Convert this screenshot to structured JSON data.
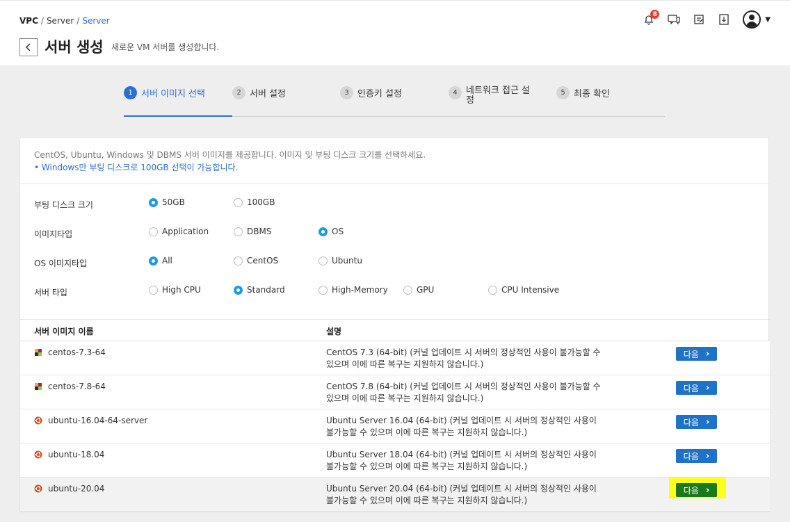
{
  "breadcrumb": {
    "item1": "VPC",
    "item2": "Server",
    "item3": "Server",
    "sep": "/"
  },
  "page": {
    "title": "서버 생성",
    "subtitle": "새로운 VM 서버를 생성합니다."
  },
  "header": {
    "notification_count": "8"
  },
  "steps": [
    {
      "num": "1",
      "label": "서버 이미지 선택"
    },
    {
      "num": "2",
      "label": "서버 설정"
    },
    {
      "num": "3",
      "label": "인증키 설정"
    },
    {
      "num": "4",
      "label": "네트워크 접근 설정"
    },
    {
      "num": "5",
      "label": "최종 확인"
    }
  ],
  "info": {
    "text": "CentOS, Ubuntu, Windows 및 DBMS 서버 이미지를 제공합니다. 이미지 및 부팅 디스크 크기를 선택하세요.",
    "note": "Windows만 부팅 디스크로 100GB 선택이 가능합니다."
  },
  "options": {
    "boot_disk": {
      "label": "부팅 디스크 크기",
      "choices": [
        "50GB",
        "100GB"
      ],
      "selected": "50GB"
    },
    "image_type": {
      "label": "이미지타입",
      "choices": [
        "Application",
        "DBMS",
        "OS"
      ],
      "selected": "OS"
    },
    "os_image_type": {
      "label": "OS 이미지타입",
      "choices": [
        "All",
        "CentOS",
        "Ubuntu"
      ],
      "selected": "All"
    },
    "server_type": {
      "label": "서버 타입",
      "choices": [
        "High CPU",
        "Standard",
        "High-Memory",
        "GPU",
        "CPU Intensive"
      ],
      "selected": "Standard"
    }
  },
  "table": {
    "col_name": "서버 이미지 이름",
    "col_desc": "설명",
    "next_label": "다음",
    "rows": [
      {
        "name": "centos-7.3-64",
        "icon": "centos-icon",
        "desc1": "CentOS 7.3 (64-bit) (커널 업데이트 시 서버의 정상적인 사용이 불가능할 수",
        "desc2": "있으며 이에 따른 복구는 지원하지 않습니다.)"
      },
      {
        "name": "centos-7.8-64",
        "icon": "centos-icon",
        "desc1": "CentOS 7.8 (64-bit) (커널 업데이트 시 서버의 정상적인 사용이 불가능할 수",
        "desc2": "있으며 이에 따른 복구는 지원하지 않습니다.)"
      },
      {
        "name": "ubuntu-16.04-64-server",
        "icon": "ubuntu-icon",
        "desc1": "Ubuntu Server 16.04 (64-bit) (커널 업데이트 시 서버의 정상적인 사용이",
        "desc2": "불가능할 수 있으며 이에 따른 복구는 지원하지 않습니다.)"
      },
      {
        "name": "ubuntu-18.04",
        "icon": "ubuntu-icon",
        "desc1": "Ubuntu Server 18.04 (64-bit) (커널 업데이트 시 서버의 정상적인 사용이",
        "desc2": "불가능할 수 있으며 이에 따른 복구는 지원하지 않습니다.)"
      },
      {
        "name": "ubuntu-20.04",
        "icon": "ubuntu-icon",
        "desc1": "Ubuntu Server 20.04 (64-bit) (커널 업데이트 시 서버의 정상적인 사용이",
        "desc2": "불가능할 수 있으며 이에 따른 복구는 지원하지 않습니다.)"
      }
    ]
  },
  "colors": {
    "accent": "#2a6fd6",
    "radio_on": "#1a9be8",
    "button": "#1e73c8",
    "highlight": "#ffff1a",
    "highlight_button": "#1a7a1a"
  }
}
